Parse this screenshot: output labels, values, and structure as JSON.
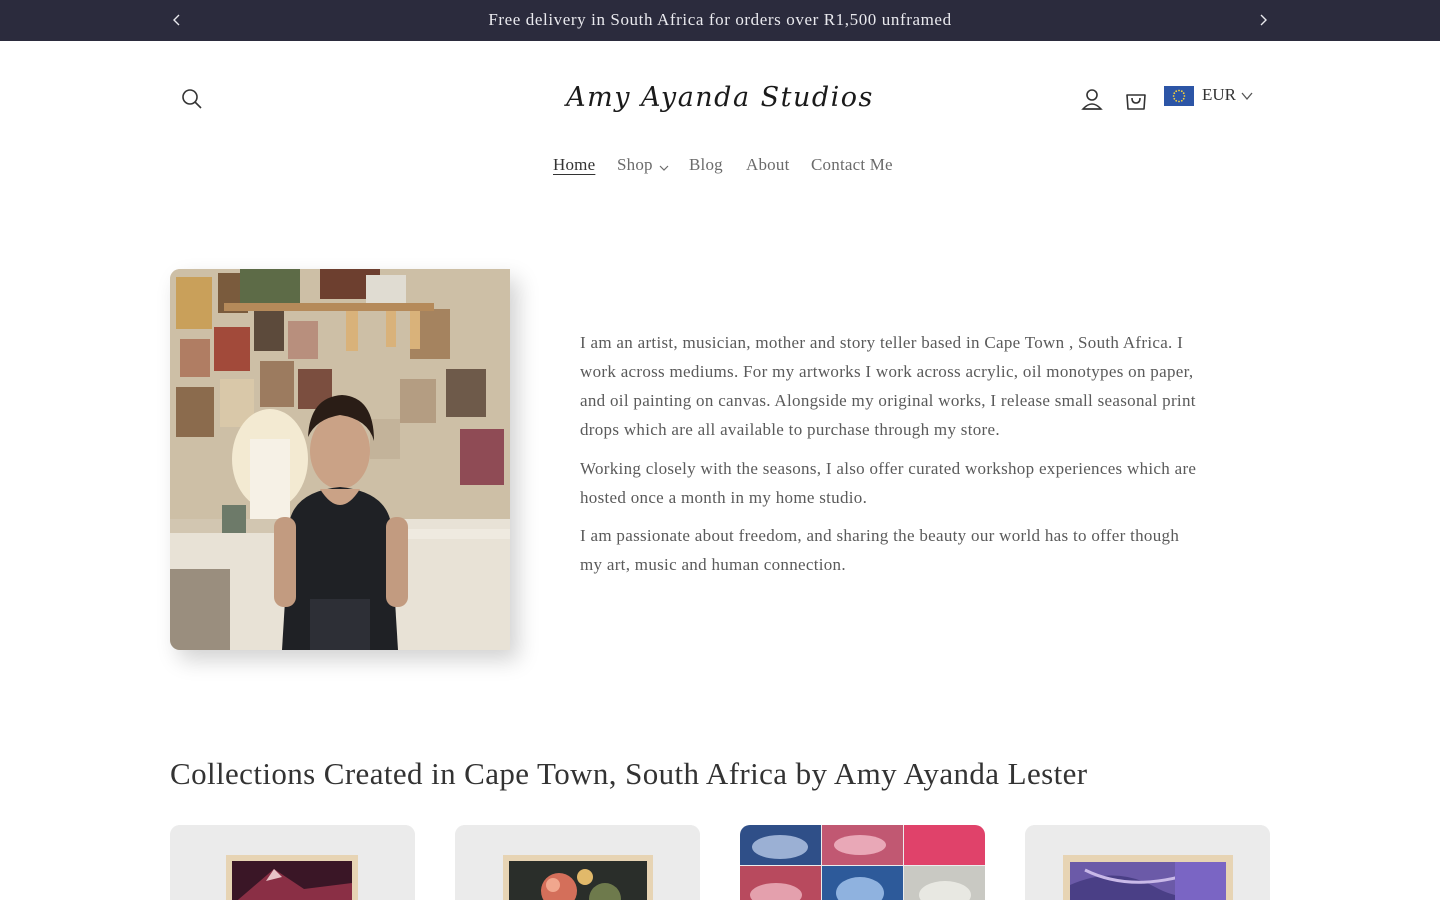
{
  "announcement": {
    "message": "Free delivery in South Africa for orders over R1,500 unframed",
    "bg_color": "#2b2b3d"
  },
  "header": {
    "logo_text": "Amy Ayanda Studios",
    "icons": [
      "search-icon",
      "account-icon",
      "cart-icon"
    ],
    "currency": {
      "code": "EUR",
      "flag": "eu-flag-icon"
    }
  },
  "nav": {
    "items": [
      {
        "label": "Home",
        "active": true
      },
      {
        "label": "Shop",
        "has_dropdown": true
      },
      {
        "label": "Blog"
      },
      {
        "label": "About"
      },
      {
        "label": "Contact Me"
      }
    ]
  },
  "about": {
    "paragraphs": [
      "I am an artist, musician, mother and story teller based in Cape Town , South Africa. I work across mediums. For my artworks I work across acrylic, oil monotypes on paper, and oil painting on canvas. Alongside my original works, I release small seasonal print drops which are all available to purchase through my store.",
      "Working closely with the seasons, I also offer curated workshop experiences which are hosted once a month in my home studio.",
      "I am passionate about freedom, and sharing the beauty our world has to offer though my art, music and human connection."
    ]
  },
  "collections": {
    "title": "Collections Created in Cape Town, South Africa by Amy Ayanda Lester",
    "cards": [
      {
        "image": "framed-mountain-print"
      },
      {
        "image": "framed-floral-print"
      },
      {
        "image": "monotype-collage"
      },
      {
        "image": "framed-abstract-print"
      }
    ]
  }
}
